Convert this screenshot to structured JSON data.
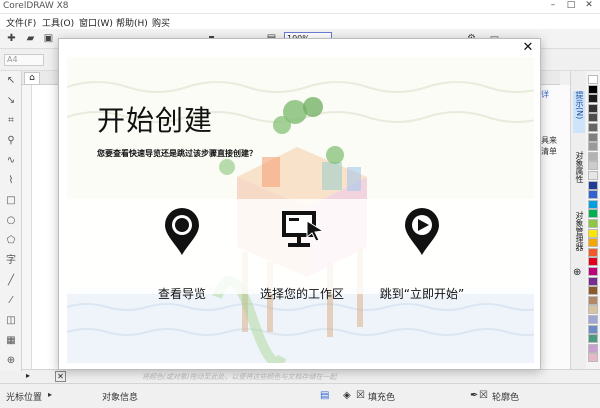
{
  "app": {
    "title": "CorelDRAW X8"
  },
  "window": {
    "minimize": "–",
    "maximize": "□",
    "close": "✕"
  },
  "menu": [
    "文件(F)",
    "工具(O)",
    "窗口(W)",
    "帮助(H)",
    "购买"
  ],
  "toolbar": {
    "zoom": "100%"
  },
  "propbar": {
    "field_placeholder": "A4"
  },
  "home_tab": "⌂",
  "right_panel": {
    "text1": "详",
    "text2": "具来",
    "text3": "清单"
  },
  "dockers": [
    {
      "label": "提示(N)",
      "active": true
    },
    {
      "label": "对象属性",
      "active": false
    },
    {
      "label": "对象管理器",
      "active": false
    }
  ],
  "palette": [
    "#ffffff",
    "#000000",
    "#1a1a1a",
    "#333333",
    "#4d4d4d",
    "#666666",
    "#808080",
    "#999999",
    "#b3b3b3",
    "#cccccc",
    "#e6e6e6",
    "#1f3c99",
    "#2f63d4",
    "#00a0e0",
    "#00b050",
    "#8dc63f",
    "#ffe600",
    "#f7a600",
    "#f05a28",
    "#e2001a",
    "#c0007a",
    "#7a2b8f",
    "#8b5a2b",
    "#b08868",
    "#d8c3a5",
    "#a0a7d8",
    "#6d8bc6",
    "#4a9b7f",
    "#c7a0d0",
    "#e9b8c6"
  ],
  "page_hint": "将颜色(或对象)拖动至此处，以便将这些颜色与文档存储在一起",
  "status": {
    "cursor_position": "光标位置",
    "object_info": "对象信息",
    "fill": "填充色",
    "outline": "轮廓色"
  },
  "dialog": {
    "close": "✕",
    "title": "开始创建",
    "subtitle": "您要查看快速导览还是跳过该步骤直接创建？",
    "options": [
      {
        "label": "查看导览",
        "icon": "location-pin-icon"
      },
      {
        "label": "选择您的工作区",
        "icon": "monitor-cursor-icon"
      },
      {
        "label": "跳到“立即开始”",
        "icon": "play-pin-icon"
      }
    ]
  },
  "colors": {
    "accent": "#2f63d4",
    "dialog_bg": "#ffffff"
  }
}
